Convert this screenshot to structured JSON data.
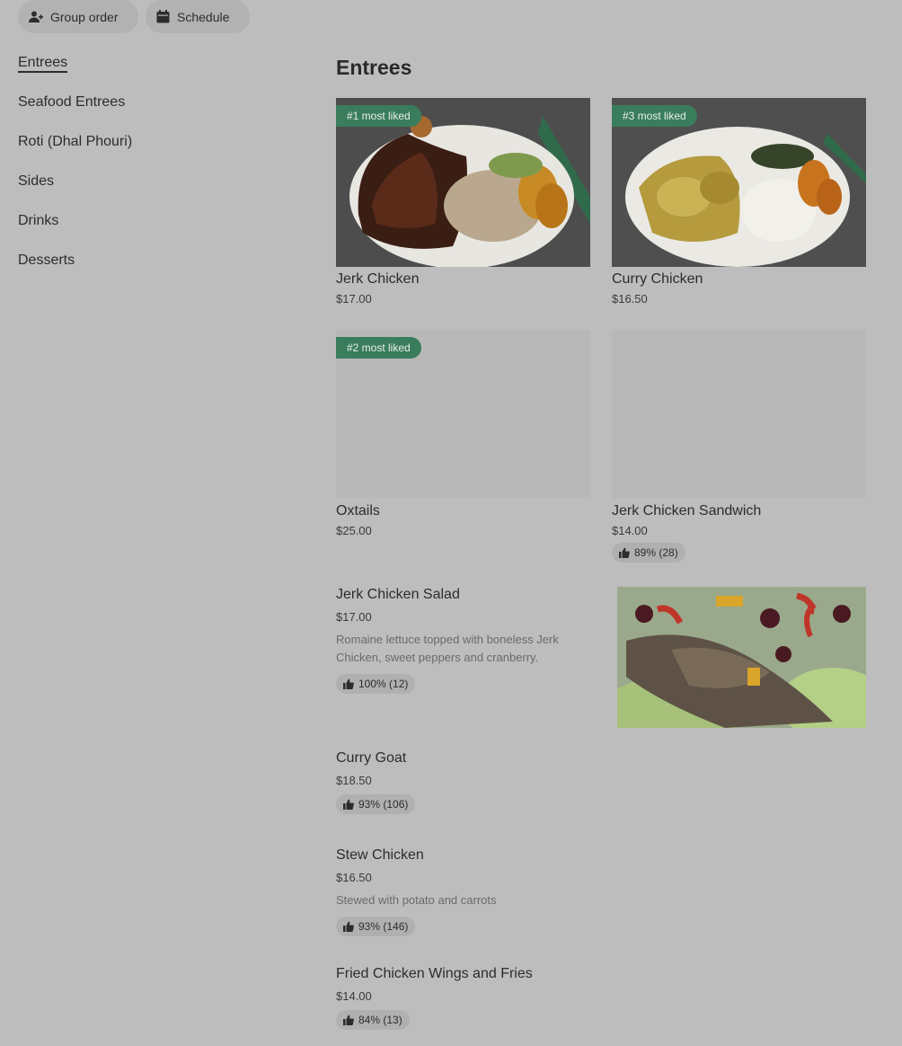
{
  "header": {
    "group_order_label": "Group order",
    "schedule_label": "Schedule"
  },
  "sidebar": {
    "items": [
      {
        "label": "Entrees",
        "active": true
      },
      {
        "label": "Seafood Entrees"
      },
      {
        "label": "Roti (Dhal Phouri)"
      },
      {
        "label": "Sides"
      },
      {
        "label": "Drinks"
      },
      {
        "label": "Desserts"
      }
    ]
  },
  "section": {
    "title": "Entrees"
  },
  "cards": [
    {
      "name": "Jerk Chicken",
      "price": "$17.00",
      "badge": "#1 most liked"
    },
    {
      "name": "Curry Chicken",
      "price": "$16.50",
      "badge": "#3 most liked"
    },
    {
      "name": "Oxtails",
      "price": "$25.00",
      "badge": "#2 most liked"
    },
    {
      "name": "Jerk Chicken Sandwich",
      "price": "$14.00",
      "rating": "89% (28)"
    }
  ],
  "list": [
    {
      "name": "Jerk Chicken Salad",
      "price": "$17.00",
      "desc": "Romaine lettuce topped with boneless Jerk Chicken, sweet peppers and cranberry.",
      "rating": "100% (12)"
    },
    {
      "name": "Curry Goat",
      "price": "$18.50",
      "rating": "93% (106)"
    },
    {
      "name": "Stew Chicken",
      "price": "$16.50",
      "desc": "Stewed with potato and carrots",
      "rating": "93% (146)"
    },
    {
      "name": "Fried Chicken Wings and Fries",
      "price": "$14.00",
      "rating": "84% (13)"
    }
  ],
  "colors": {
    "background": "#bdbdbd",
    "badge": "#3a7d5c",
    "pill": "#b2b2b2"
  }
}
